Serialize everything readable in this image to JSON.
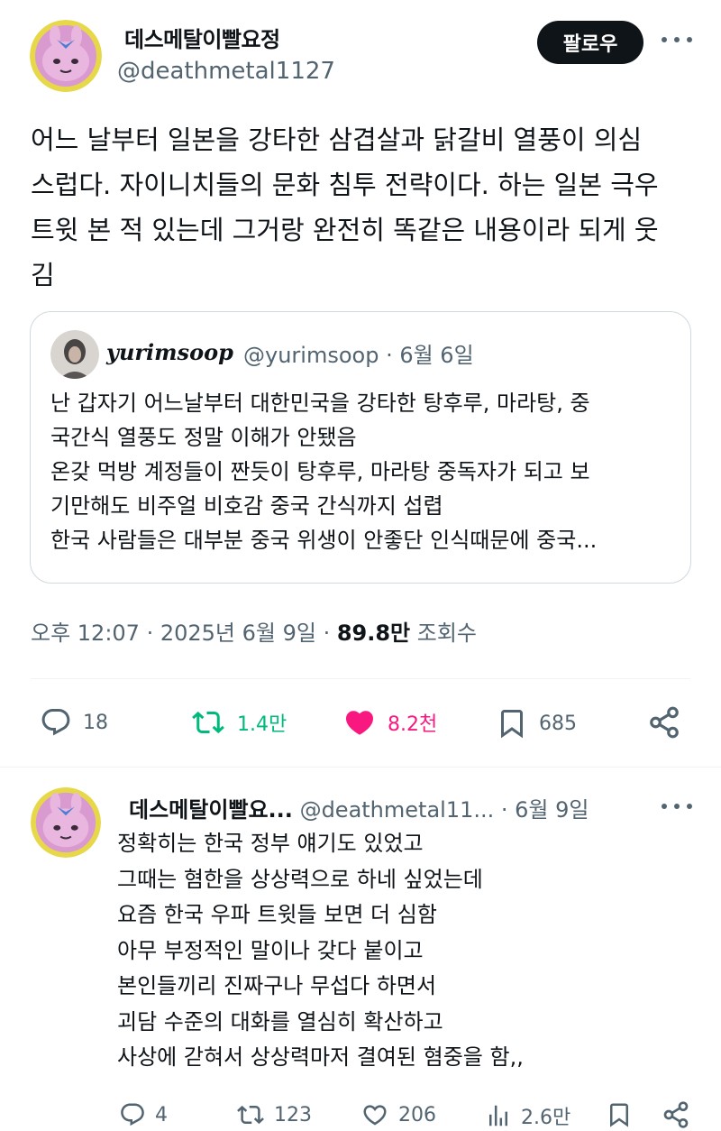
{
  "tweet": {
    "display_name": "데스메탈이빨요정",
    "handle": "@deathmetal1127",
    "follow_label": "팔로우",
    "text_lines": [
      "어느 날부터 일본을 강타한 삼겹살과 닭갈비 열풍이 의심",
      "스럽다. 자이니치들의 문화 침투 전략이다. 하는 일본 극우",
      "트윗 본 적 있는데 그거랑 완전히 똑같은 내용이라 되게 웃",
      "김"
    ],
    "timestamp": "오후 12:07 · 2025년 6월 9일 · ",
    "views_count": "89.8만",
    "views_label": " 조회수",
    "stats": {
      "replies": "18",
      "retweets": "1.4만",
      "likes": "8.2천",
      "bookmarks": "685"
    }
  },
  "quote": {
    "display_name": "yurimsoop",
    "meta": "@yurimsoop · 6월 6일",
    "text_lines": [
      "난 갑자기 어느날부터 대한민국을 강타한 탕후루, 마라탕, 중",
      "국간식 열풍도 정말 이해가 안됐음",
      "온갖 먹방 계정들이 짠듯이 탕후루, 마라탕 중독자가 되고 보",
      "기만해도 비주얼 비호감 중국 간식까지 섭렵",
      "한국 사람들은 대부분 중국 위생이 안좋단 인식때문에 중국..."
    ]
  },
  "reply": {
    "display_name": "데스메탈이빨요...",
    "meta": "@deathmetal11... · 6월 9일",
    "text_lines": [
      "정확히는 한국 정부 얘기도 있었고",
      "그때는 혐한을 상상력으로 하네 싶었는데",
      "요즘 한국 우파 트윗들 보면 더 심함",
      "아무 부정적인 말이나 갖다 붙이고",
      "본인들끼리 진짜구나 무섭다 하면서",
      "괴담 수준의 대화를 열심히 확산하고",
      "사상에 갇혀서 상상력마저 결여된 혐중을 함,,"
    ],
    "stats": {
      "replies": "4",
      "retweets": "123",
      "likes": "206",
      "views": "2.6만"
    }
  },
  "colors": {
    "text": "#0f1419",
    "secondary": "#536471",
    "retweet_green": "#00ba7c",
    "like_pink": "#f91880",
    "border": "#cfd9de"
  },
  "icons": [
    "reply-icon",
    "retweet-icon",
    "like-icon",
    "bookmark-icon",
    "share-icon",
    "views-icon",
    "more-icon"
  ]
}
